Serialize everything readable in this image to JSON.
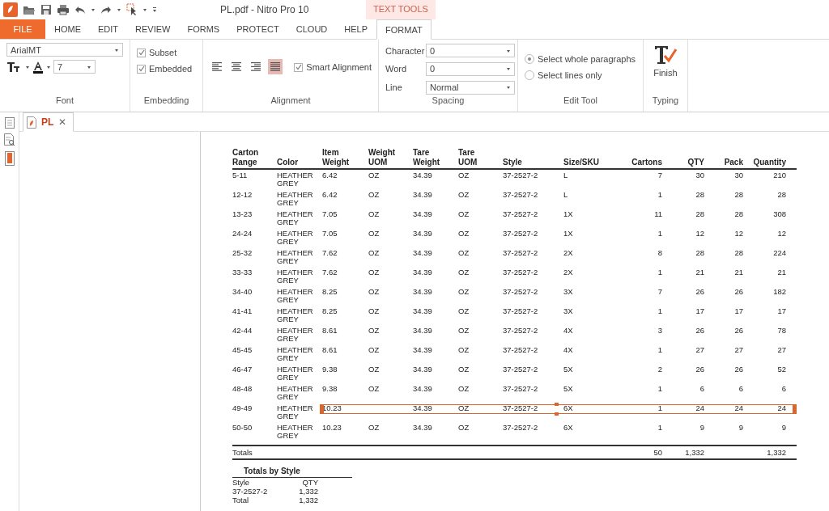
{
  "window": {
    "title": "PL.pdf - Nitro Pro 10",
    "context_tab": "TEXT TOOLS"
  },
  "menu_tabs": [
    {
      "label": "FILE",
      "kind": "file",
      "selected": false
    },
    {
      "label": "HOME",
      "kind": "tab",
      "selected": false
    },
    {
      "label": "EDIT",
      "kind": "tab",
      "selected": false
    },
    {
      "label": "REVIEW",
      "kind": "tab",
      "selected": false
    },
    {
      "label": "FORMS",
      "kind": "tab",
      "selected": false
    },
    {
      "label": "PROTECT",
      "kind": "tab",
      "selected": false
    },
    {
      "label": "CLOUD",
      "kind": "tab",
      "selected": false
    },
    {
      "label": "HELP",
      "kind": "tab",
      "selected": false
    },
    {
      "label": "FORMAT",
      "kind": "tab",
      "selected": true
    }
  ],
  "ribbon": {
    "font": {
      "label": "Font",
      "font_name": "ArialMT",
      "font_size": "7"
    },
    "embedding": {
      "label": "Embedding",
      "options": [
        {
          "label": "Subset",
          "checked": true
        },
        {
          "label": "Embedded",
          "checked": true
        }
      ]
    },
    "alignment": {
      "label": "Alignment",
      "buttons": [
        {
          "kind": "left",
          "selected": false
        },
        {
          "kind": "center",
          "selected": false
        },
        {
          "kind": "right",
          "selected": false
        },
        {
          "kind": "justify",
          "selected": true
        }
      ],
      "smart_alignment": {
        "label": "Smart Alignment",
        "checked": true
      }
    },
    "spacing": {
      "label": "Spacing",
      "fields": [
        {
          "label": "Character",
          "value": "0"
        },
        {
          "label": "Word",
          "value": "0"
        },
        {
          "label": "Line",
          "value": "Normal"
        }
      ]
    },
    "edit_tool": {
      "label": "Edit Tool",
      "options": [
        {
          "label": "Select whole paragraphs",
          "selected": true
        },
        {
          "label": "Select lines only",
          "selected": false
        }
      ]
    },
    "typing": {
      "label": "Typing",
      "button": "Finish"
    }
  },
  "document_tab": {
    "label": "PL",
    "close": "✕"
  },
  "table": {
    "columns": [
      {
        "label": "Carton Range"
      },
      {
        "label": "Color"
      },
      {
        "label": "Item Weight"
      },
      {
        "label": "Weight UOM"
      },
      {
        "label": "Tare Weight"
      },
      {
        "label": "Tare UOM"
      },
      {
        "label": "Style"
      },
      {
        "label": "Size/SKU"
      },
      {
        "label": "Cartons"
      },
      {
        "label": "QTY"
      },
      {
        "label": "Pack"
      },
      {
        "label": "Quantity"
      }
    ],
    "rows": [
      {
        "cells": [
          "5-11",
          "HEATHER GREY",
          "6.42",
          "OZ",
          "34.39",
          "OZ",
          "37-2527-2",
          "L",
          "7",
          "30",
          "30",
          "210"
        ],
        "selected": false
      },
      {
        "cells": [
          "12-12",
          "HEATHER GREY",
          "6.42",
          "OZ",
          "34.39",
          "OZ",
          "37-2527-2",
          "L",
          "1",
          "28",
          "28",
          "28"
        ],
        "selected": false
      },
      {
        "cells": [
          "13-23",
          "HEATHER GREY",
          "7.05",
          "OZ",
          "34.39",
          "OZ",
          "37-2527-2",
          "1X",
          "11",
          "28",
          "28",
          "308"
        ],
        "selected": false
      },
      {
        "cells": [
          "24-24",
          "HEATHER GREY",
          "7.05",
          "OZ",
          "34.39",
          "OZ",
          "37-2527-2",
          "1X",
          "1",
          "12",
          "12",
          "12"
        ],
        "selected": false
      },
      {
        "cells": [
          "25-32",
          "HEATHER GREY",
          "7.62",
          "OZ",
          "34.39",
          "OZ",
          "37-2527-2",
          "2X",
          "8",
          "28",
          "28",
          "224"
        ],
        "selected": false
      },
      {
        "cells": [
          "33-33",
          "HEATHER GREY",
          "7.62",
          "OZ",
          "34.39",
          "OZ",
          "37-2527-2",
          "2X",
          "1",
          "21",
          "21",
          "21"
        ],
        "selected": false
      },
      {
        "cells": [
          "34-40",
          "HEATHER GREY",
          "8.25",
          "OZ",
          "34.39",
          "OZ",
          "37-2527-2",
          "3X",
          "7",
          "26",
          "26",
          "182"
        ],
        "selected": false
      },
      {
        "cells": [
          "41-41",
          "HEATHER GREY",
          "8.25",
          "OZ",
          "34.39",
          "OZ",
          "37-2527-2",
          "3X",
          "1",
          "17",
          "17",
          "17"
        ],
        "selected": false
      },
      {
        "cells": [
          "42-44",
          "HEATHER GREY",
          "8.61",
          "OZ",
          "34.39",
          "OZ",
          "37-2527-2",
          "4X",
          "3",
          "26",
          "26",
          "78"
        ],
        "selected": false
      },
      {
        "cells": [
          "45-45",
          "HEATHER GREY",
          "8.61",
          "OZ",
          "34.39",
          "OZ",
          "37-2527-2",
          "4X",
          "1",
          "27",
          "27",
          "27"
        ],
        "selected": false
      },
      {
        "cells": [
          "46-47",
          "HEATHER GREY",
          "9.38",
          "OZ",
          "34.39",
          "OZ",
          "37-2527-2",
          "5X",
          "2",
          "26",
          "26",
          "52"
        ],
        "selected": false
      },
      {
        "cells": [
          "48-48",
          "HEATHER GREY",
          "9.38",
          "OZ",
          "34.39",
          "OZ",
          "37-2527-2",
          "5X",
          "1",
          "6",
          "6",
          "6"
        ],
        "selected": false
      },
      {
        "cells": [
          "49-49",
          "HEATHER GREY",
          "10.23",
          null,
          "34.39",
          "OZ",
          "37-2527-2",
          "6X",
          "1",
          "24",
          "24",
          "24"
        ],
        "selected": true
      },
      {
        "cells": [
          "50-50",
          "HEATHER GREY",
          "10.23",
          "OZ",
          "34.39",
          "OZ",
          "37-2527-2",
          "6X",
          "1",
          "9",
          "9",
          "9"
        ],
        "selected": false
      }
    ],
    "totals": {
      "label": "Totals",
      "cartons": "50",
      "qty": "1,332",
      "quantity": "1,332"
    }
  },
  "totals_by_style": {
    "title": "Totals by  Style",
    "columns": [
      "Style",
      "QTY"
    ],
    "rows": [
      [
        "37-2527-2",
        "1,332"
      ],
      [
        "Total",
        "1,332"
      ]
    ]
  }
}
